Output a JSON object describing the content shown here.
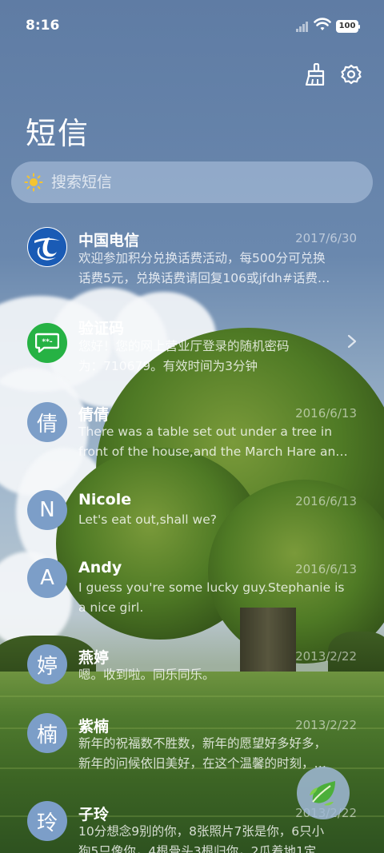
{
  "status_bar": {
    "time": "8:16",
    "battery": "100"
  },
  "header": {
    "title": "短信"
  },
  "search": {
    "placeholder": "搜索短信"
  },
  "messages": [
    {
      "name": "中国电信",
      "date": "2017/6/30",
      "preview_line1": "欢迎参加积分兑换话费活动，每500分可兑换",
      "preview_line2": "话费5元，兑换话费请回复106或jfdh#话费…"
    },
    {
      "name": "验证码",
      "date": "",
      "preview_line1": "您好！您的网上营业厅登录的随机密码",
      "preview_line2": "为：710679。有效时间为3分钟"
    },
    {
      "name": "倩倩",
      "avatar_char": "倩",
      "date": "2016/6/13",
      "preview_line1": "There was a table set out under a tree in",
      "preview_line2": "front of the house,and the March Hare an…"
    },
    {
      "name": "Nicole",
      "avatar_char": "N",
      "date": "2016/6/13",
      "preview_line1": "Let's eat out,shall we?",
      "preview_line2": ""
    },
    {
      "name": "Andy",
      "avatar_char": "A",
      "date": "2016/6/13",
      "preview_line1": "I guess you're some lucky guy.Stephanie is",
      "preview_line2": "a nice girl."
    },
    {
      "name": "燕婷",
      "avatar_char": "婷",
      "date": "2013/2/22",
      "preview_line1": "嗯。收到啦。同乐同乐。",
      "preview_line2": ""
    },
    {
      "name": "紫楠",
      "avatar_char": "楠",
      "date": "2013/2/22",
      "preview_line1": "新年的祝福数不胜数，新年的愿望好多好多，",
      "preview_line2": "新年的问候依旧美好，在这个温馨的时刻，…"
    },
    {
      "name": "子玲",
      "avatar_char": "玲",
      "date": "2013/2/22",
      "preview_line1": "10分想念9别的你，8张照片7张是你，6只小",
      "preview_line2": "狗5只像你，4根骨头3根归你，2瓜着地1定"
    }
  ],
  "icons": {
    "clean": "broom-icon",
    "settings": "gear-icon",
    "search": "sun-icon",
    "compose": "leaf-icon",
    "chevron": "chevron-right-icon"
  },
  "colors": {
    "avatar_blue": "#7c9ec8",
    "code_green": "#26b244",
    "telecom_blue": "#1a5bb5"
  }
}
